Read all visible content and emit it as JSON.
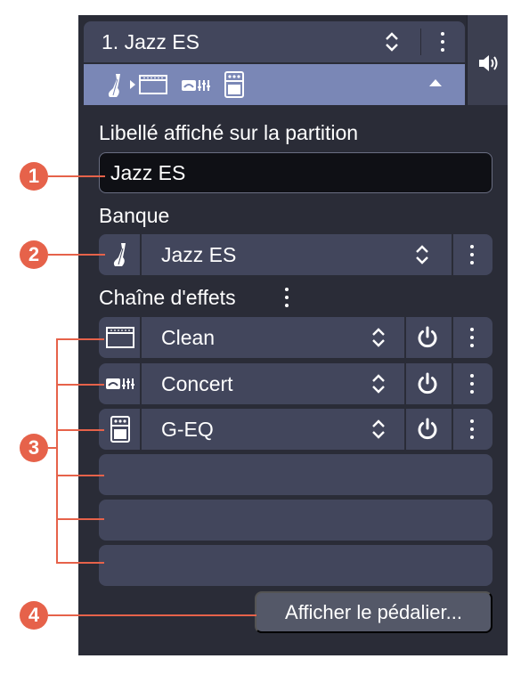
{
  "header": {
    "preset_name": "1. Jazz ES"
  },
  "score_label": {
    "title": "Libellé affiché sur la partition",
    "value": "Jazz ES"
  },
  "bank": {
    "title": "Banque",
    "selected": "Jazz ES"
  },
  "effects_chain": {
    "title": "Chaîne d'effets",
    "slots": [
      {
        "label": "Clean",
        "icon": "amp-head-icon"
      },
      {
        "label": "Concert",
        "icon": "cabinet-eq-icon"
      },
      {
        "label": "G-EQ",
        "icon": "pedal-icon"
      }
    ],
    "empty_slots": 3
  },
  "pedalboard_button": "Afficher le pédalier...",
  "callouts": [
    "1",
    "2",
    "3",
    "4"
  ],
  "colors": {
    "panel": "#2a2c37",
    "row": "#42465c",
    "chain_bar": "#7a87b6",
    "callout": "#e6624a"
  }
}
